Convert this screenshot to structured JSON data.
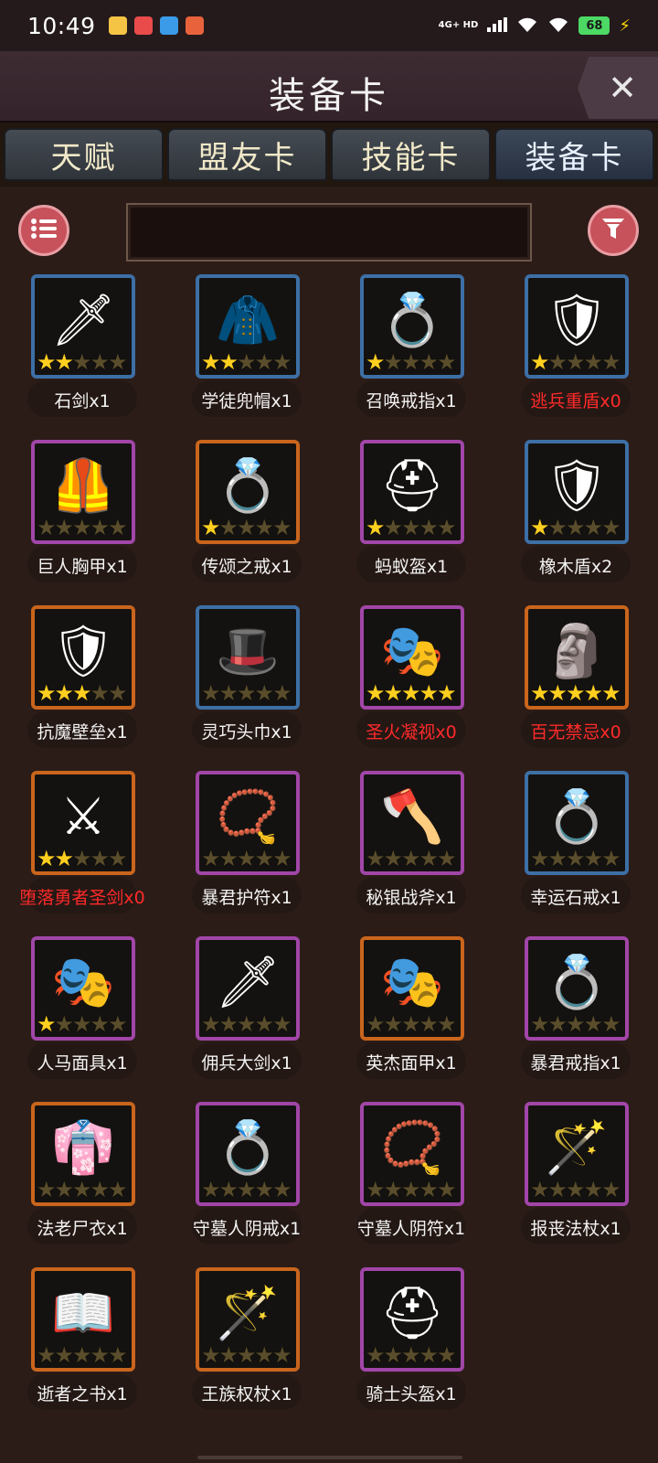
{
  "status": {
    "time": "10:49",
    "network": "4G+ HD",
    "battery": "68",
    "apps": [
      {
        "name": "app-icon-1",
        "color": "#f6c445"
      },
      {
        "name": "app-icon-2",
        "color": "#e94b4b"
      },
      {
        "name": "app-icon-3",
        "color": "#3b9be8"
      },
      {
        "name": "app-icon-4",
        "color": "#e8623b"
      }
    ]
  },
  "header": {
    "title": "装备卡",
    "close_icon": "close-icon"
  },
  "tabs": [
    {
      "label": "天赋",
      "active": false
    },
    {
      "label": "盟友卡",
      "active": false
    },
    {
      "label": "技能卡",
      "active": false
    },
    {
      "label": "装备卡",
      "active": true
    }
  ],
  "search": {
    "value": "",
    "placeholder": ""
  },
  "items": [
    {
      "label": "石剑x1",
      "rarity": "blue",
      "stars": 2,
      "owned": true,
      "icon": "sword-icon",
      "glyph": "🗡"
    },
    {
      "label": "学徒兜帽x1",
      "rarity": "blue",
      "stars": 2,
      "owned": true,
      "icon": "hood-icon",
      "glyph": "🧥"
    },
    {
      "label": "召唤戒指x1",
      "rarity": "blue",
      "stars": 1,
      "owned": true,
      "icon": "ring-icon",
      "glyph": "💍"
    },
    {
      "label": "逃兵重盾x0",
      "rarity": "blue",
      "stars": 1,
      "owned": false,
      "icon": "shield-icon",
      "glyph": "🛡"
    },
    {
      "label": "巨人胸甲x1",
      "rarity": "purple",
      "stars": 0,
      "owned": true,
      "icon": "chestplate-icon",
      "glyph": "🦺"
    },
    {
      "label": "传颂之戒x1",
      "rarity": "orange",
      "stars": 1,
      "owned": true,
      "icon": "ring-icon",
      "glyph": "💍"
    },
    {
      "label": "蚂蚁盔x1",
      "rarity": "purple",
      "stars": 1,
      "owned": true,
      "icon": "helmet-icon",
      "glyph": "⛑"
    },
    {
      "label": "橡木盾x2",
      "rarity": "blue",
      "stars": 1,
      "owned": true,
      "icon": "shield-icon",
      "glyph": "🛡"
    },
    {
      "label": "抗魔壁垒x1",
      "rarity": "orange",
      "stars": 3,
      "owned": true,
      "icon": "shield-icon",
      "glyph": "🛡"
    },
    {
      "label": "灵巧头巾x1",
      "rarity": "blue",
      "stars": 0,
      "owned": true,
      "icon": "hat-icon",
      "glyph": "🎩"
    },
    {
      "label": "圣火凝视x0",
      "rarity": "purple",
      "stars": 5,
      "owned": false,
      "icon": "mask-icon",
      "glyph": "🎭"
    },
    {
      "label": "百无禁忌x0",
      "rarity": "orange",
      "stars": 5,
      "owned": false,
      "icon": "totem-icon",
      "glyph": "🗿"
    },
    {
      "label": "堕落勇者圣剑x0",
      "rarity": "orange",
      "stars": 2,
      "owned": false,
      "icon": "sword-icon",
      "glyph": "⚔"
    },
    {
      "label": "暴君护符x1",
      "rarity": "purple",
      "stars": 0,
      "owned": true,
      "icon": "amulet-icon",
      "glyph": "📿"
    },
    {
      "label": "秘银战斧x1",
      "rarity": "purple",
      "stars": 0,
      "owned": true,
      "icon": "axe-icon",
      "glyph": "🪓"
    },
    {
      "label": "幸运石戒x1",
      "rarity": "blue",
      "stars": 0,
      "owned": true,
      "icon": "ring-icon",
      "glyph": "💍"
    },
    {
      "label": "人马面具x1",
      "rarity": "purple",
      "stars": 1,
      "owned": true,
      "icon": "mask-icon",
      "glyph": "🎭"
    },
    {
      "label": "佣兵大剑x1",
      "rarity": "purple",
      "stars": 0,
      "owned": true,
      "icon": "sword-icon",
      "glyph": "🗡"
    },
    {
      "label": "英杰面甲x1",
      "rarity": "orange",
      "stars": 0,
      "owned": true,
      "icon": "mask-icon",
      "glyph": "🎭"
    },
    {
      "label": "暴君戒指x1",
      "rarity": "purple",
      "stars": 0,
      "owned": true,
      "icon": "ring-icon",
      "glyph": "💍"
    },
    {
      "label": "法老尸衣x1",
      "rarity": "orange",
      "stars": 0,
      "owned": true,
      "icon": "robe-icon",
      "glyph": "👘"
    },
    {
      "label": "守墓人阴戒x1",
      "rarity": "purple",
      "stars": 0,
      "owned": true,
      "icon": "ring-icon",
      "glyph": "💍"
    },
    {
      "label": "守墓人阴符x1",
      "rarity": "purple",
      "stars": 0,
      "owned": true,
      "icon": "amulet-icon",
      "glyph": "📿"
    },
    {
      "label": "报丧法杖x1",
      "rarity": "purple",
      "stars": 0,
      "owned": true,
      "icon": "staff-icon",
      "glyph": "🪄"
    },
    {
      "label": "逝者之书x1",
      "rarity": "orange",
      "stars": 0,
      "owned": true,
      "icon": "book-icon",
      "glyph": "📖"
    },
    {
      "label": "王族权杖x1",
      "rarity": "orange",
      "stars": 0,
      "owned": true,
      "icon": "scepter-icon",
      "glyph": "🪄"
    },
    {
      "label": "骑士头盔x1",
      "rarity": "purple",
      "stars": 0,
      "owned": true,
      "icon": "helmet-icon",
      "glyph": "⛑"
    }
  ]
}
